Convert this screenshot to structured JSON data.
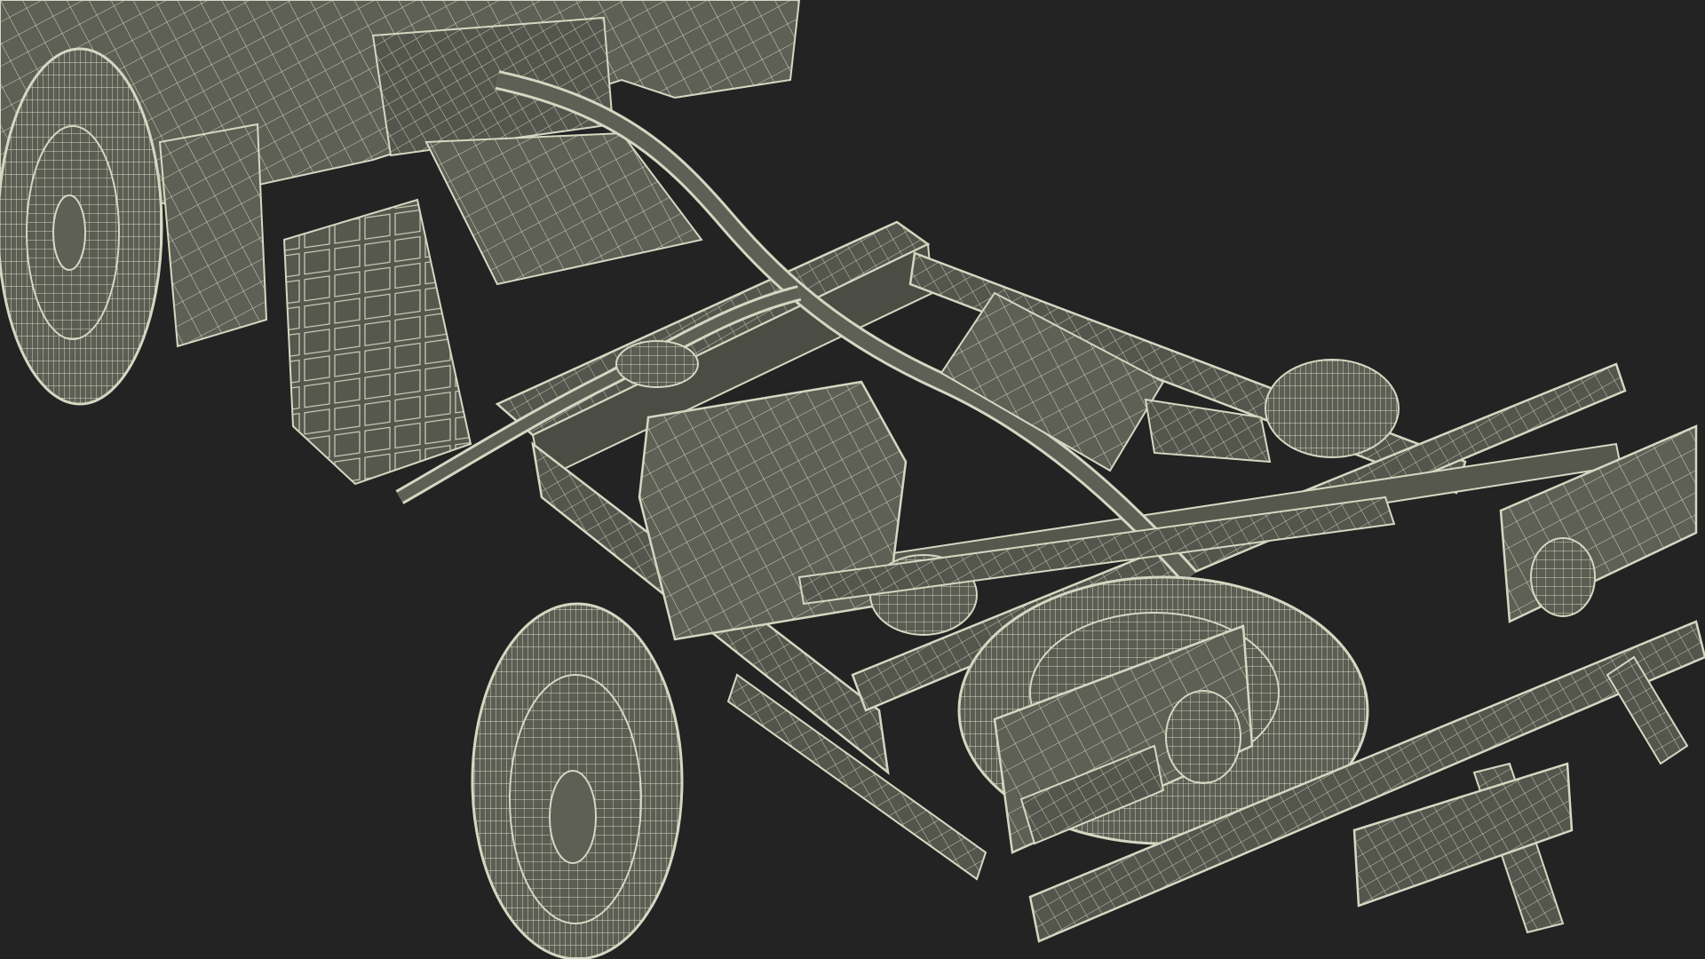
{
  "scene": {
    "subject": "truck-chassis-wireframe",
    "background_color": "#232323",
    "mesh_fill_color": "#5e5f55",
    "mesh_fill_dark": "#4b4c43",
    "wire_color": "#d6d7c2",
    "wire_color_dim": "#a9aa97"
  }
}
